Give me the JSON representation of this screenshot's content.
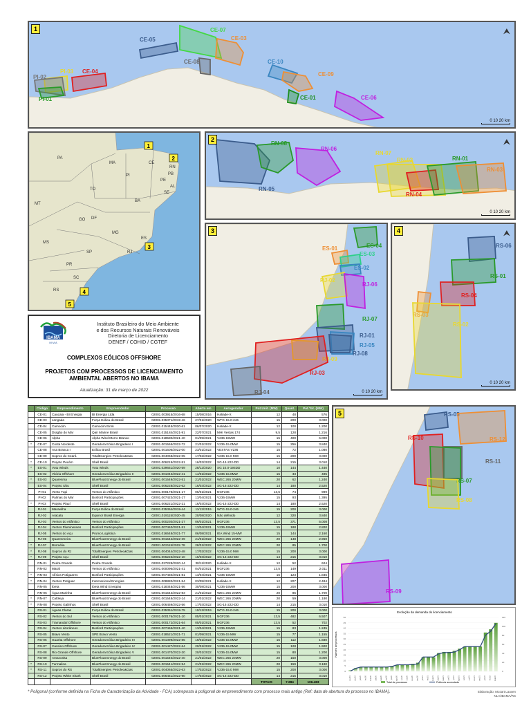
{
  "maps": {
    "panel1": {
      "number": "1",
      "labels": [
        "CE-05",
        "CE-07",
        "CE-03",
        "CE-08",
        "CE-10",
        "CE-09",
        "CE-04",
        "PI-03",
        "PI-02",
        "PI-01",
        "CE-01",
        "CE-06"
      ],
      "scale": "0   10   20 km"
    },
    "panel2": {
      "number": "2",
      "labels": [
        "RN-05",
        "RN-08",
        "RN-06",
        "RN-07",
        "RN-02",
        "RN-04",
        "RN-01",
        "RN-03"
      ],
      "scale": "0   10   20 km"
    },
    "panel3": {
      "number": "3",
      "labels": [
        "ES-04",
        "ES-01",
        "ES-03",
        "ES-02",
        "RJ-02",
        "RJ-06",
        "RJ-07",
        "RJ-01",
        "RJ-05",
        "RJ-08",
        "RJ-09",
        "RJ-03",
        "RJ-04"
      ],
      "scale": "0   10   20 km"
    },
    "panel4": {
      "number": "4",
      "labels": [
        "RS-06",
        "RS-01",
        "RS-04",
        "RS-03",
        "RS-02"
      ],
      "scale": "0   10   20 km"
    },
    "panel5": {
      "number": "5",
      "labels": [
        "RS-05",
        "RS-12",
        "RS-10",
        "RS-11",
        "RS-07",
        "RS-08",
        "RS-09"
      ]
    },
    "brazil": {
      "states": [
        "PA",
        "MA",
        "CE",
        "RN",
        "PB",
        "PE",
        "AL",
        "SE",
        "PI",
        "TO",
        "BA",
        "MT",
        "GO",
        "DF",
        "MG",
        "ES",
        "MS",
        "SP",
        "RJ",
        "PR",
        "SC",
        "RS"
      ],
      "boxes": [
        "1",
        "2",
        "3",
        "4",
        "5"
      ]
    }
  },
  "info": {
    "logo_text": "IBAMA",
    "logo_sub": "M M A",
    "institute": [
      "Instituto Brasileiro do Meio Ambiente",
      "e dos Recursos Naturais Renováveis",
      "Diretoria de Licenciamento",
      "DENEF / COHID / CGTEF"
    ],
    "title": "COMPLEXOS EÓLICOS OFFSHORE",
    "subtitle": [
      "PROJETOS COM PROCESSOS DE LICENCIAMENTO",
      "AMBIENTAL  ABERTOS NO IBAMA"
    ],
    "updated": "Atualização: 31 de março de 2022"
  },
  "table": {
    "headers": [
      "",
      "Código",
      "Empreendimento",
      "Empreendedor",
      "Processo",
      "Aberto em",
      "Aerogerador",
      "Pot.Unit. (MW)",
      "Quant.",
      "Pot.Tot. (MW)"
    ],
    "rows": [
      [
        "",
        "CE-01",
        "Caucaia - BI Energia",
        "BI Energia Ltda",
        "02001.003915/2016-68",
        "15/08/2016",
        "Haliade-X",
        "12",
        "48",
        "576"
      ],
      [
        "",
        "CE-03",
        "Jangada",
        "Força Eólica do Brasil",
        "02001.035371/2019-46",
        "27/01/2020",
        "WTG-15.0-246",
        "15",
        "200",
        "3.000"
      ],
      [
        "",
        "CE-04",
        "Camocim",
        "Camocim Eireli",
        "02001.015445/2020-61",
        "06/07/2020",
        "Haliade-X",
        "12",
        "100",
        "1.200"
      ],
      [
        "",
        "CE-05",
        "Dragão do Mar",
        "Qair Marine Brasil",
        "02001.015184/2021-91",
        "22/07/2021",
        "MHI Vestas 174",
        "9,5",
        "128",
        "1.216"
      ],
      [
        "",
        "CE-06",
        "Alpha",
        "Alpha Wind Morro Branco",
        "02001.018580/2021-40",
        "01/09/2021",
        "V236-15MW",
        "15",
        "400",
        "6.000"
      ],
      [
        "*",
        "CE-07",
        "Costa Nordeste",
        "Geradora Eólica Brigadeiro I",
        "02001.001565/2022-72",
        "21/01/2022",
        "V236-15.0MW",
        "15",
        "256",
        "3.840"
      ],
      [
        "",
        "CE-08",
        "Asa Branca I",
        "Eólica Brasil",
        "02001.001606/2022-00",
        "23/01/2022",
        "VESTAS V236",
        "15",
        "72",
        "1.080"
      ],
      [
        "",
        "CE-09",
        "Sopros do Ceará",
        "TotalEnergies Petroleo&Gas",
        "02001.004068/2022-05",
        "17/02/2022",
        "V236-15.0 MW",
        "15",
        "200",
        "3.000"
      ],
      [
        "*",
        "CE-10",
        "Projeto Pecém",
        "Shell Brasil",
        "02001.006219/2022-51",
        "16/03/2022",
        "SG-14-222-DD",
        "14",
        "215",
        "3.010"
      ],
      [
        "*",
        "ES-01",
        "Votu Winds",
        "Votu Winds",
        "02001.029651/2020-59",
        "28/12/2020",
        "SG 10.0-193DD",
        "10",
        "144",
        "1.440"
      ],
      [
        "",
        "ES-02",
        "Vitória Offshore",
        "Geradora Eólica Brigadeiro II",
        "02001.001043/2022-41",
        "14/01/2022",
        "V236-15.0MW",
        "15",
        "33",
        "495"
      ],
      [
        "*",
        "ES-03",
        "Quaresma",
        "BlueFloat Energy do Brasil",
        "02001.001549/2022-51",
        "21/01/2022",
        "WEC 265 20MW",
        "20",
        "62",
        "1.240"
      ],
      [
        "",
        "ES-04",
        "Projeto Ubu",
        "Shell Brasil",
        "02001.006228/2022-62",
        "16/03/2022",
        "SG-14-222-DD",
        "14",
        "180",
        "2.520"
      ],
      [
        "",
        "PI-01",
        "Vento Tupi",
        "Ventos do Atlântico",
        "02001.000178/2021-17",
        "05/01/2021",
        "NGF236",
        "13,5",
        "74",
        "999"
      ],
      [
        "",
        "PI-02",
        "Palmas do Mar",
        "Bosford Participações",
        "02001.007423/2021-17",
        "13/04/2021",
        "V236-15MW",
        "15",
        "93",
        "1.395"
      ],
      [
        "*",
        "PI-03",
        "Projeto Piauí",
        "Shell Brasil",
        "02001.006221/2022-21",
        "16/03/2022",
        "SG-14-222-DD",
        "14",
        "180",
        "2.520"
      ],
      [
        "",
        "RJ-01",
        "Maravilha",
        "Força Eólica do Brasil",
        "02001.035364/2019-44",
        "11/12/2019",
        "WTG-15.0-246",
        "15",
        "200",
        "3.000"
      ],
      [
        "",
        "RJ-02",
        "Aracatu",
        "Equinor Brasil Energia",
        "02001.019115/2020-45",
        "20/08/2020",
        "Não definido",
        "12",
        "320",
        "3.840"
      ],
      [
        "",
        "RJ-03",
        "Ventos do Atlântico",
        "Ventos do Atlântico",
        "02001.000230/2021-27",
        "06/01/2021",
        "NGF236",
        "13,5",
        "371",
        "5.008"
      ],
      [
        "",
        "RJ-04",
        "Ventos Fluminenses",
        "Bosford Participações",
        "02001.007463/2021-51",
        "13/04/2021",
        "V236-15MW",
        "15",
        "188",
        "2.820"
      ],
      [
        "",
        "RJ-05",
        "Ventos do Açu",
        "Prumo Logística",
        "02001.016548/2021-77",
        "06/08/2021",
        "IEA Wind 15-MW",
        "15",
        "144",
        "2.160"
      ],
      [
        "",
        "RJ-06",
        "Quaresmeira",
        "BlueFloat Energy do Brasil",
        "02001.001542/2022-39",
        "21/01/2022",
        "WEC 265 20MW",
        "20",
        "148",
        "2.960"
      ],
      [
        "*",
        "RJ-07",
        "Bromélia",
        "BlueFloat Energy do Brasil",
        "02001.002115/2022-78",
        "28/01/2022",
        "WEC 265 20MW",
        "20",
        "85",
        "1.700"
      ],
      [
        "*",
        "RJ-08",
        "Sopros do RJ",
        "TotalEnergies Petroleo&Gas",
        "02001.004044/2022-48",
        "17/02/2022",
        "V236-15.0 MW",
        "15",
        "200",
        "3.000"
      ],
      [
        "*",
        "RJ-09",
        "Projeto Açu",
        "Shell Brasil",
        "02001.006223/2022-10",
        "16/03/2022",
        "SG-14-222-DD",
        "14",
        "215",
        "3.010"
      ],
      [
        "",
        "RN-01",
        "Pedra Grande",
        "Pedra Grande",
        "02001.027228/2020-14",
        "30/11/2020",
        "Haliade-X",
        "12",
        "52",
        "624"
      ],
      [
        "",
        "RN-02",
        "Maral",
        "Ventos do Atlântico",
        "02001.000096/2021-41",
        "04/01/2021",
        "NGF236",
        "13,5",
        "149",
        "2.011"
      ],
      [
        "*",
        "RN-03",
        "Alísios Potiguares",
        "Bosford Participações",
        "02001.007450/2021-81",
        "13/04/2021",
        "V236-15MW",
        "15",
        "123",
        "1.845"
      ],
      [
        "*",
        "RN-04",
        "Ventos Potiguar",
        "Internacional Energias",
        "02001.008883/2021-54",
        "03/05/2021",
        "Haliade-X",
        "12",
        "207",
        "2.484"
      ],
      [
        "",
        "RN-05",
        "Ibeta",
        "Ibeta Wind Energias",
        "02001.018348/2021-56",
        "30/08/2021",
        "V236-15MW",
        "15",
        "200",
        "3.000"
      ],
      [
        "",
        "RN-06",
        "Água Marinha",
        "BlueFloat Energy do Brasil",
        "02001.001543/2022-83",
        "21/01/2022",
        "WEC 265 20MW",
        "20",
        "85",
        "1.700"
      ],
      [
        "*",
        "RN-07",
        "Cattleya",
        "BlueFloat Energy do Brasil",
        "02001.001548/2022-14",
        "21/01/2022",
        "WEC 265 20MW",
        "20",
        "59",
        "1.180"
      ],
      [
        "*",
        "RN-08",
        "Projeto Galinhos",
        "Shell Brasil",
        "02001.006459/2022-56",
        "17/03/2022",
        "SG-14-222-DD",
        "14",
        "215",
        "3.010"
      ],
      [
        "",
        "RS-01",
        "Águas Claras",
        "Força Eólica do Brasil",
        "02001.035351/2019-75",
        "10/12/2019",
        "WTG-15.0-246",
        "15",
        "200",
        "3.000"
      ],
      [
        "",
        "RS-02",
        "Ventos do Sul",
        "Ventos do Atlântico",
        "02001.000176/2021-10",
        "05/01/2021",
        "NGF236",
        "13,5",
        "482",
        "6.507"
      ],
      [
        "",
        "RS-03",
        "Tramandaí Offshore",
        "Ventos do Atlântico",
        "02001.000172/2021-64",
        "05/01/2021",
        "NGF236",
        "13,5",
        "52",
        "702"
      ],
      [
        "",
        "RS-04",
        "Ventos Litorâneos",
        "Bosford Participações",
        "02001.007465/2021-40",
        "13/04/2021",
        "V236-15MW",
        "15",
        "83",
        "1.245"
      ],
      [
        "",
        "RS-05",
        "Bravo Vento",
        "SPE Bravo Vento",
        "02001.018521/2021-71",
        "01/09/2021",
        "V236-15 MW",
        "15",
        "77",
        "1.155"
      ],
      [
        "",
        "RS-06",
        "Guarita Offshore",
        "Geradora Eólica Brigadeiro III",
        "02001.001399/2022-85",
        "19/01/2022",
        "V236-15.0MW",
        "15",
        "112",
        "1.680"
      ],
      [
        "",
        "RS-07",
        "Cassino Offshore",
        "Geradora Eólica Brigadeiro IV",
        "02001.001427/2022-64",
        "20/01/2022",
        "V236-15.0MW",
        "15",
        "128",
        "1.920"
      ],
      [
        "",
        "RS-08",
        "Rio Grande Offshore",
        "Geradora Eólica Brigadeiro V",
        "02001.001470/2022-20",
        "20/01/2022",
        "V236-15.0MW",
        "15",
        "80",
        "1.200"
      ],
      [
        "",
        "RS-09",
        "Amazonita",
        "BlueFloat Energy do Brasil",
        "02001.001540/2022-40",
        "21/01/2022",
        "WEC 265 20MW",
        "20",
        "150",
        "3.000"
      ],
      [
        "*",
        "RS-10",
        "Turmalina",
        "BlueFloat Energy do Brasil",
        "02001.001541/2022-94",
        "21/01/2022",
        "WEC 265 20MW",
        "20",
        "159",
        "3.180"
      ],
      [
        "*",
        "RS-11",
        "Sopros do RS",
        "TotalEnergies Petroleo&Gas",
        "02001.004065/2022-63",
        "17/02/2022",
        "V236-15.0 MW",
        "15",
        "200",
        "3.000"
      ],
      [
        "",
        "RS-12",
        "Projeto White Shark",
        "Shell Brasil",
        "02001.006451/2022-90",
        "17/03/2022",
        "SG-14-222-DD",
        "14",
        "215",
        "3.010"
      ]
    ],
    "totals": {
      "label": "TOTAIS",
      "quant": "7.284",
      "power": "106.483"
    }
  },
  "chart_data": {
    "type": "bar+line",
    "title": "Evolução da demanda do licenciamento",
    "ylabel": "Número de processos",
    "categories": [
      "nov/19",
      "dez/19",
      "jan/20",
      "fev/20",
      "mar/20",
      "abr/20",
      "mai/20",
      "jun/20",
      "jul/20",
      "ago/20",
      "set/20",
      "out/20",
      "nov/20",
      "dez/20",
      "jan/21",
      "fev/21",
      "mar/21",
      "abr/21",
      "mai/21",
      "jun/21",
      "jul/21",
      "ago/21",
      "set/21",
      "out/21",
      "nov/21",
      "dez/21",
      "jan/22",
      "fev/22",
      "mar/22"
    ],
    "series": [
      {
        "name": "Total de processos",
        "type": "bar",
        "axis": "left",
        "color": "#6aaa4a",
        "values": [
          1,
          3,
          4,
          4,
          4,
          4,
          4,
          4,
          5,
          6,
          6,
          6,
          7,
          8,
          13,
          13,
          13,
          17,
          18,
          18,
          19,
          21,
          23,
          23,
          23,
          23,
          36,
          39,
          45
        ]
      },
      {
        "name": "Potência acumulada",
        "type": "line",
        "axis": "right",
        "color": "#2f4a7a",
        "values": [
          0.6,
          6.6,
          9.6,
          9.6,
          9.6,
          9.6,
          9.6,
          9.6,
          10.8,
          14.6,
          14.6,
          14.6,
          15.2,
          16.7,
          31.9,
          31.9,
          31.9,
          39.2,
          41.7,
          41.7,
          42.9,
          48.1,
          55.2,
          55.2,
          55.2,
          55.2,
          80.4,
          89.4,
          106.5
        ]
      }
    ],
    "ylim": [
      0,
      50
    ],
    "yticks": [
      0,
      5,
      10,
      15,
      20,
      25,
      30,
      35,
      40,
      45,
      50
    ],
    "y2lim": [
      0,
      120
    ],
    "y2ticks": [
      0,
      20,
      40,
      60,
      80,
      100,
      120
    ],
    "legend": "bottom"
  },
  "footer": {
    "note": "* Poligonal (conforme definida na Ficha de Caracterização da Atividade - FCA) sobreposta à poligonal de empreendimento com processo mais antigo (Ref: data de abertura do processo no IBAMA).",
    "credit": [
      "Elaboração: Mozart Lauxen",
      "NLA/IBAMA/RS"
    ]
  }
}
